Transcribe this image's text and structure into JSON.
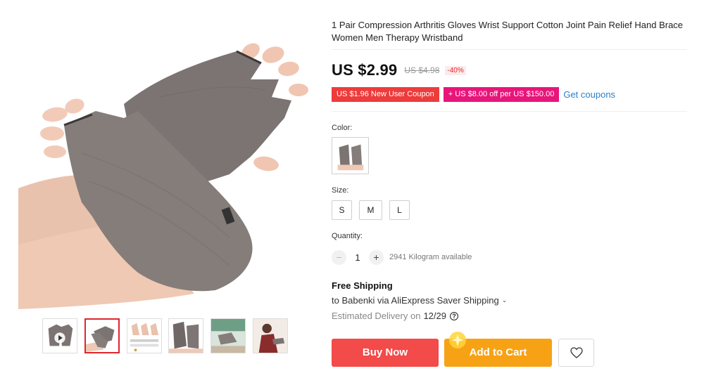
{
  "product": {
    "title": "1 Pair Compression Arthritis Gloves Wrist Support Cotton Joint Pain Relief Hand Brace Women Men Therapy Wristband"
  },
  "gallery": {
    "main_image": "grey-fingerless-compression-gloves-photo",
    "thumbnails": [
      {
        "icon": "gloves-video-thumbnail",
        "active": false
      },
      {
        "icon": "gloves-on-hands-thumbnail",
        "active": true
      },
      {
        "icon": "size-chart-thumbnail",
        "active": false
      },
      {
        "icon": "gloves-detail-thumbnail",
        "active": false
      },
      {
        "icon": "gloves-lifestyle-thumbnail",
        "active": false
      },
      {
        "icon": "person-wearing-thumbnail",
        "active": false
      }
    ]
  },
  "pricing": {
    "price": "US $2.99",
    "original_price": "US $4.98",
    "discount": "-40%"
  },
  "coupons": {
    "new_user": "US $1.96 New User Coupon",
    "store": "+ US $8.00 off per US $150.00",
    "get_link": "Get coupons"
  },
  "options": {
    "color_label": "Color:",
    "size_label": "Size:",
    "sizes": [
      "S",
      "M",
      "L"
    ],
    "quantity_label": "Quantity:",
    "quantity_value": "1",
    "minus": "−",
    "plus": "+",
    "available": "2941 Kilogram available"
  },
  "shipping": {
    "title": "Free Shipping",
    "route": "to Babenki via AliExpress Saver Shipping",
    "chevron": "⌄",
    "delivery_label": "Estimated Delivery on",
    "delivery_date": "12/29",
    "help": "?"
  },
  "actions": {
    "buy_now": "Buy Now",
    "add_to_cart": "Add to Cart"
  },
  "colors": {
    "buy_now": "#f34a4a",
    "add_to_cart": "#f7a215",
    "coupon_red": "#ee3b3b",
    "coupon_pink": "#e8157a",
    "link": "#2a7fc9",
    "active_thumb_border": "#e0252c"
  }
}
